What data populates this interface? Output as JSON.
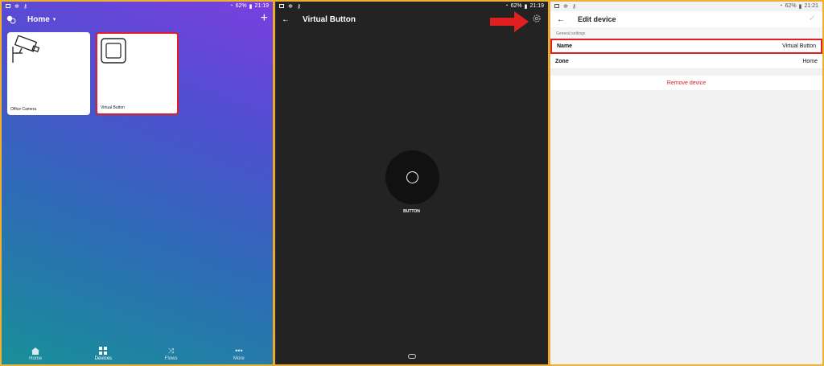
{
  "panel1": {
    "status": {
      "battery": "62%",
      "time": "21:19"
    },
    "header": {
      "title": "Home",
      "plus_icon": "plus-icon"
    },
    "devices": [
      {
        "label": "Office Camera",
        "icon": "camera-icon"
      },
      {
        "label": "Virtual Button",
        "icon": "button-icon",
        "selected": true
      }
    ],
    "nav": [
      {
        "label": "Home",
        "icon": "home-icon"
      },
      {
        "label": "Devices",
        "icon": "grid-icon",
        "active": true
      },
      {
        "label": "Flows",
        "icon": "flows-icon"
      },
      {
        "label": "More",
        "icon": "more-icon"
      }
    ]
  },
  "panel2": {
    "status": {
      "battery": "62%",
      "time": "21:19"
    },
    "header": {
      "title": "Virtual Button"
    },
    "button_label": "BUTTON",
    "arrow_color": "#e02020"
  },
  "panel3": {
    "status": {
      "battery": "62%",
      "time": "21:21"
    },
    "header": {
      "title": "Edit device"
    },
    "section": "General settings",
    "rows": [
      {
        "label": "Name",
        "value": "Virtual Button",
        "selected": true
      },
      {
        "label": "Zone",
        "value": "Home"
      }
    ],
    "remove_label": "Remove device",
    "accent_color": "#e02020"
  }
}
